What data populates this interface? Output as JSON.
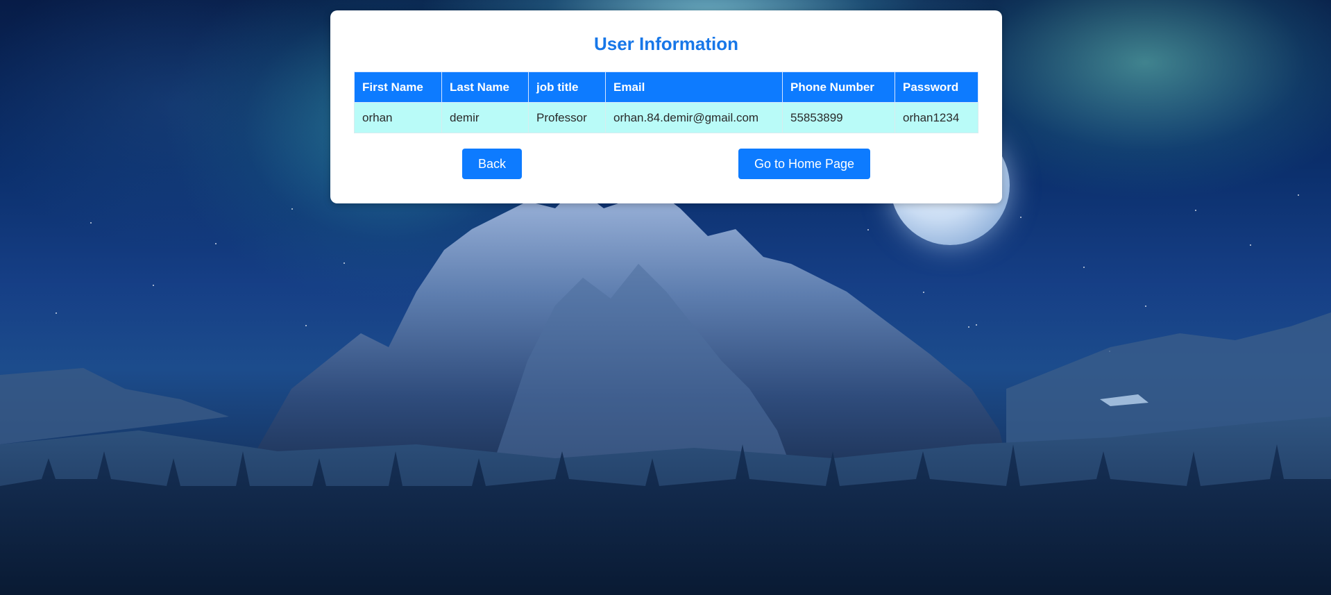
{
  "card": {
    "title": "User Information"
  },
  "table": {
    "columns": [
      "First Name",
      "Last Name",
      "job title",
      "Email",
      "Phone Number",
      "Password"
    ],
    "rows": [
      [
        "orhan",
        "demir",
        "Professor",
        "orhan.84.demir@gmail.com",
        "55853899",
        "orhan1234"
      ]
    ]
  },
  "buttons": {
    "back_label": "Back",
    "home_label": "Go to Home Page"
  },
  "colors": {
    "accent": "#0d7bff",
    "title": "#1777e8",
    "row_background": "#b9fbf8"
  }
}
